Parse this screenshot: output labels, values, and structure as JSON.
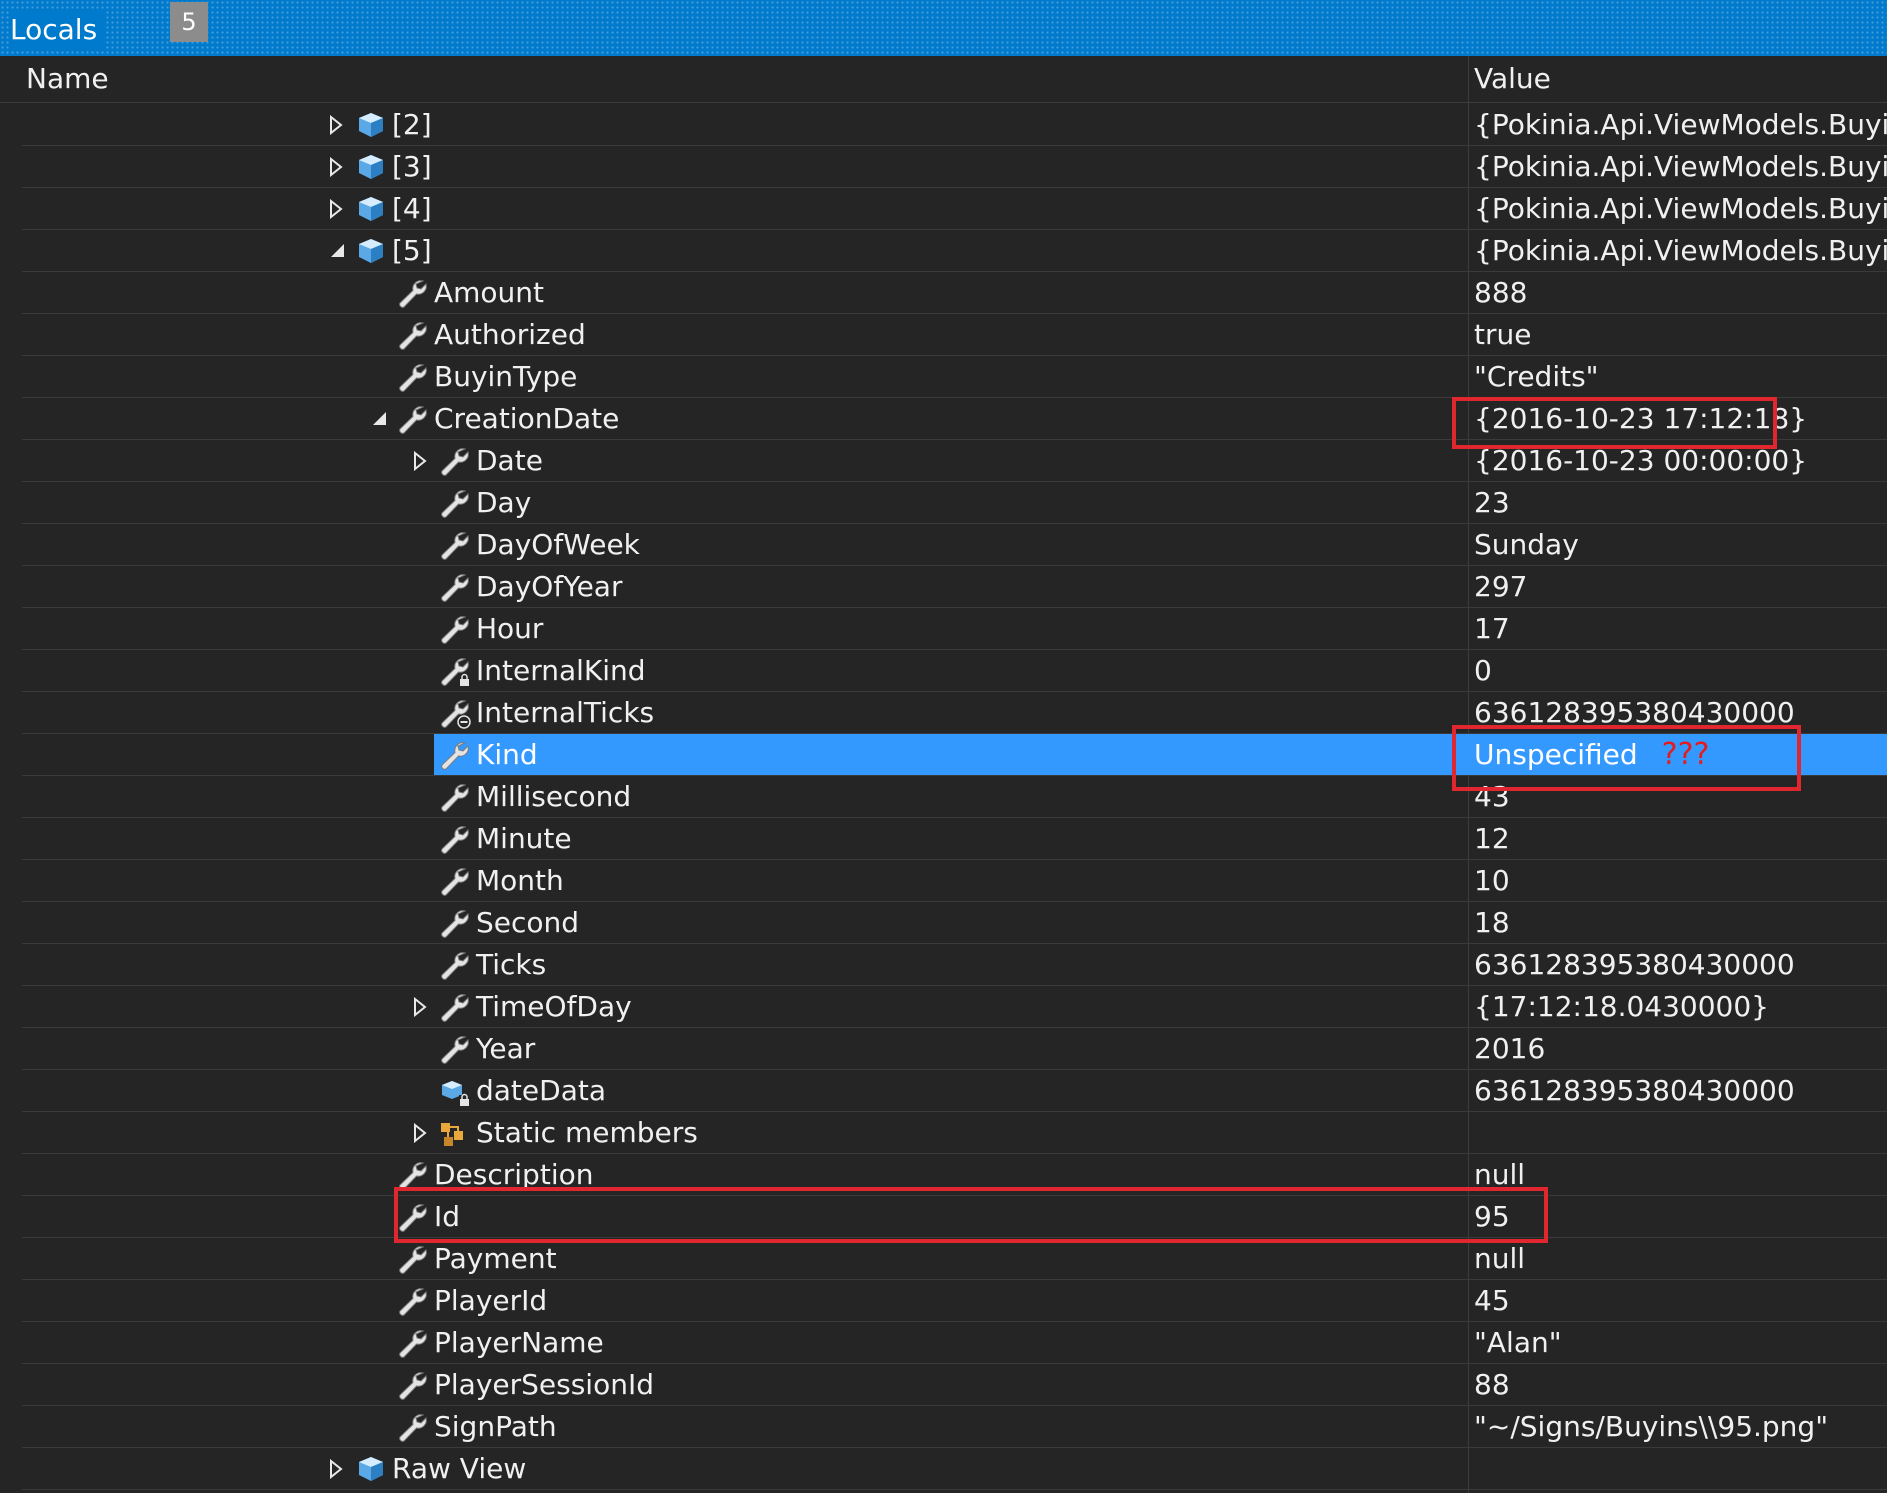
{
  "window": {
    "title": "Locals",
    "badge": "5"
  },
  "columns": {
    "name": "Name",
    "value": "Value"
  },
  "rows": [
    {
      "depth": 0,
      "expander": "collapsed",
      "icon": "object-icon",
      "name": "[2]",
      "value": "{Pokinia.Api.ViewModels.BuyinL"
    },
    {
      "depth": 0,
      "expander": "collapsed",
      "icon": "object-icon",
      "name": "[3]",
      "value": "{Pokinia.Api.ViewModels.BuyinL"
    },
    {
      "depth": 0,
      "expander": "collapsed",
      "icon": "object-icon",
      "name": "[4]",
      "value": "{Pokinia.Api.ViewModels.BuyinL"
    },
    {
      "depth": 0,
      "expander": "expanded",
      "icon": "object-icon",
      "name": "[5]",
      "value": "{Pokinia.Api.ViewModels.BuyinL"
    },
    {
      "depth": 1,
      "expander": "none",
      "icon": "property-icon",
      "name": "Amount",
      "value": "888"
    },
    {
      "depth": 1,
      "expander": "none",
      "icon": "property-icon",
      "name": "Authorized",
      "value": "true"
    },
    {
      "depth": 1,
      "expander": "none",
      "icon": "property-icon",
      "name": "BuyinType",
      "value": "\"Credits\""
    },
    {
      "depth": 1,
      "expander": "expanded",
      "icon": "property-icon",
      "name": "CreationDate",
      "value": "{2016-10-23 17:12:18}"
    },
    {
      "depth": 2,
      "expander": "collapsed",
      "icon": "property-icon",
      "name": "Date",
      "value": "{2016-10-23 00:00:00}"
    },
    {
      "depth": 2,
      "expander": "none",
      "icon": "property-icon",
      "name": "Day",
      "value": "23"
    },
    {
      "depth": 2,
      "expander": "none",
      "icon": "property-icon",
      "name": "DayOfWeek",
      "value": "Sunday"
    },
    {
      "depth": 2,
      "expander": "none",
      "icon": "property-icon",
      "name": "DayOfYear",
      "value": "297"
    },
    {
      "depth": 2,
      "expander": "none",
      "icon": "property-icon",
      "name": "Hour",
      "value": "17"
    },
    {
      "depth": 2,
      "expander": "none",
      "icon": "private-property-icon",
      "name": "InternalKind",
      "value": "0"
    },
    {
      "depth": 2,
      "expander": "none",
      "icon": "internal-property-icon",
      "name": "InternalTicks",
      "value": "636128395380430000"
    },
    {
      "depth": 2,
      "expander": "none",
      "icon": "property-icon",
      "name": "Kind",
      "value": "Unspecified",
      "selected": true,
      "note": "???"
    },
    {
      "depth": 2,
      "expander": "none",
      "icon": "property-icon",
      "name": "Millisecond",
      "value": "43"
    },
    {
      "depth": 2,
      "expander": "none",
      "icon": "property-icon",
      "name": "Minute",
      "value": "12"
    },
    {
      "depth": 2,
      "expander": "none",
      "icon": "property-icon",
      "name": "Month",
      "value": "10"
    },
    {
      "depth": 2,
      "expander": "none",
      "icon": "property-icon",
      "name": "Second",
      "value": "18"
    },
    {
      "depth": 2,
      "expander": "none",
      "icon": "property-icon",
      "name": "Ticks",
      "value": "636128395380430000"
    },
    {
      "depth": 2,
      "expander": "collapsed",
      "icon": "property-icon",
      "name": "TimeOfDay",
      "value": "{17:12:18.0430000}"
    },
    {
      "depth": 2,
      "expander": "none",
      "icon": "property-icon",
      "name": "Year",
      "value": "2016"
    },
    {
      "depth": 2,
      "expander": "none",
      "icon": "private-field-icon",
      "name": "dateData",
      "value": "636128395380430000"
    },
    {
      "depth": 2,
      "expander": "collapsed",
      "icon": "static-members-icon",
      "name": "Static members",
      "value": ""
    },
    {
      "depth": 1,
      "expander": "none",
      "icon": "property-icon",
      "name": "Description",
      "value": "null"
    },
    {
      "depth": 1,
      "expander": "none",
      "icon": "property-icon",
      "name": "Id",
      "value": "95"
    },
    {
      "depth": 1,
      "expander": "none",
      "icon": "property-icon",
      "name": "Payment",
      "value": "null"
    },
    {
      "depth": 1,
      "expander": "none",
      "icon": "property-icon",
      "name": "PlayerId",
      "value": "45"
    },
    {
      "depth": 1,
      "expander": "none",
      "icon": "property-icon",
      "name": "PlayerName",
      "value": "\"Alan\""
    },
    {
      "depth": 1,
      "expander": "none",
      "icon": "property-icon",
      "name": "PlayerSessionId",
      "value": "88"
    },
    {
      "depth": 1,
      "expander": "none",
      "icon": "property-icon",
      "name": "SignPath",
      "value": "\"~/Signs/Buyins\\\\95.png\""
    },
    {
      "depth": 0,
      "expander": "collapsed",
      "icon": "object-icon",
      "name": "Raw View",
      "value": ""
    }
  ],
  "colors": {
    "background": "#252526",
    "titlebar": "#007acc",
    "selection": "#3399ff",
    "annotation": "#e0262e"
  }
}
